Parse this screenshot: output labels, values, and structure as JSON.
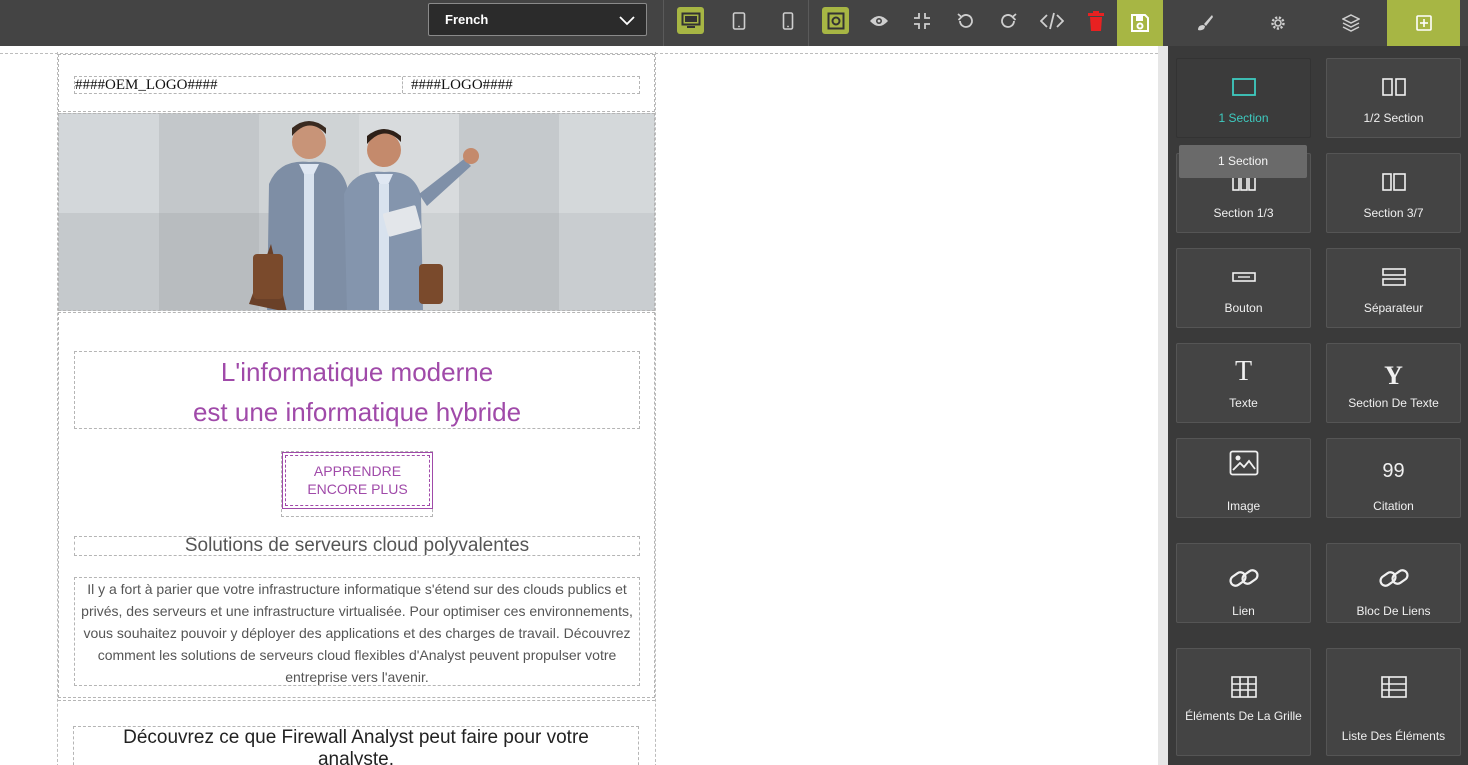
{
  "toolbar": {
    "language": "French",
    "colors": {
      "accent": "#a7b644",
      "delete": "#e82121"
    },
    "icons": [
      "desktop-icon",
      "tablet-icon",
      "mobile-icon",
      "outline-icon",
      "preview-eye-icon",
      "fullscreen-icon",
      "undo-icon",
      "redo-icon",
      "code-icon",
      "trash-icon",
      "save-icon"
    ]
  },
  "canvas": {
    "oem_logo": "####OEM_LOGO####",
    "logo": "####LOGO####",
    "headline_line1": "L'informatique moderne",
    "headline_line2": "est une informatique hybride",
    "cta_line1": "APPRENDRE",
    "cta_line2": "ENCORE PLUS",
    "subheading": "Solutions de serveurs cloud polyvalentes",
    "body": "Il y a fort à parier que votre infrastructure informatique s'étend sur des clouds publics et privés, des serveurs et une infrastructure virtualisée. Pour optimiser ces environnements, vous souhaitez pouvoir y déployer des applications et des charges de travail. Découvrez comment les solutions de serveurs cloud flexibles d'Analyst peuvent propulser votre entreprise vers l'avenir.",
    "discover_line1": "Découvrez ce que Firewall Analyst peut faire pour votre",
    "discover_line2": "analyste.",
    "accent_color": "#a04aa9"
  },
  "panel": {
    "tabs": [
      "style-brush-icon",
      "settings-gear-icon",
      "layers-icon",
      "add-block-icon"
    ],
    "tooltip": "1 Section",
    "blocks": [
      {
        "label": "1 Section",
        "icon": "one-section-icon"
      },
      {
        "label": "1/2 Section",
        "icon": "half-section-icon"
      },
      {
        "label": "Section 1/3",
        "icon": "third-section-icon"
      },
      {
        "label": "Section 3/7",
        "icon": "three-seven-section-icon"
      },
      {
        "label": "Bouton",
        "icon": "button-icon"
      },
      {
        "label": "Séparateur",
        "icon": "separator-icon"
      },
      {
        "label": "Texte",
        "icon": "text-icon"
      },
      {
        "label": "Section De Texte",
        "icon": "text-section-icon"
      },
      {
        "label": "Image",
        "icon": "image-icon"
      },
      {
        "label": "Citation",
        "icon": "quote-icon"
      },
      {
        "label": "Lien",
        "icon": "link-icon"
      },
      {
        "label": "Bloc De Liens",
        "icon": "link-block-icon"
      },
      {
        "label": "Éléments De La Grille",
        "icon": "grid-items-icon"
      },
      {
        "label": "Liste Des Éléments",
        "icon": "list-items-icon"
      }
    ]
  }
}
